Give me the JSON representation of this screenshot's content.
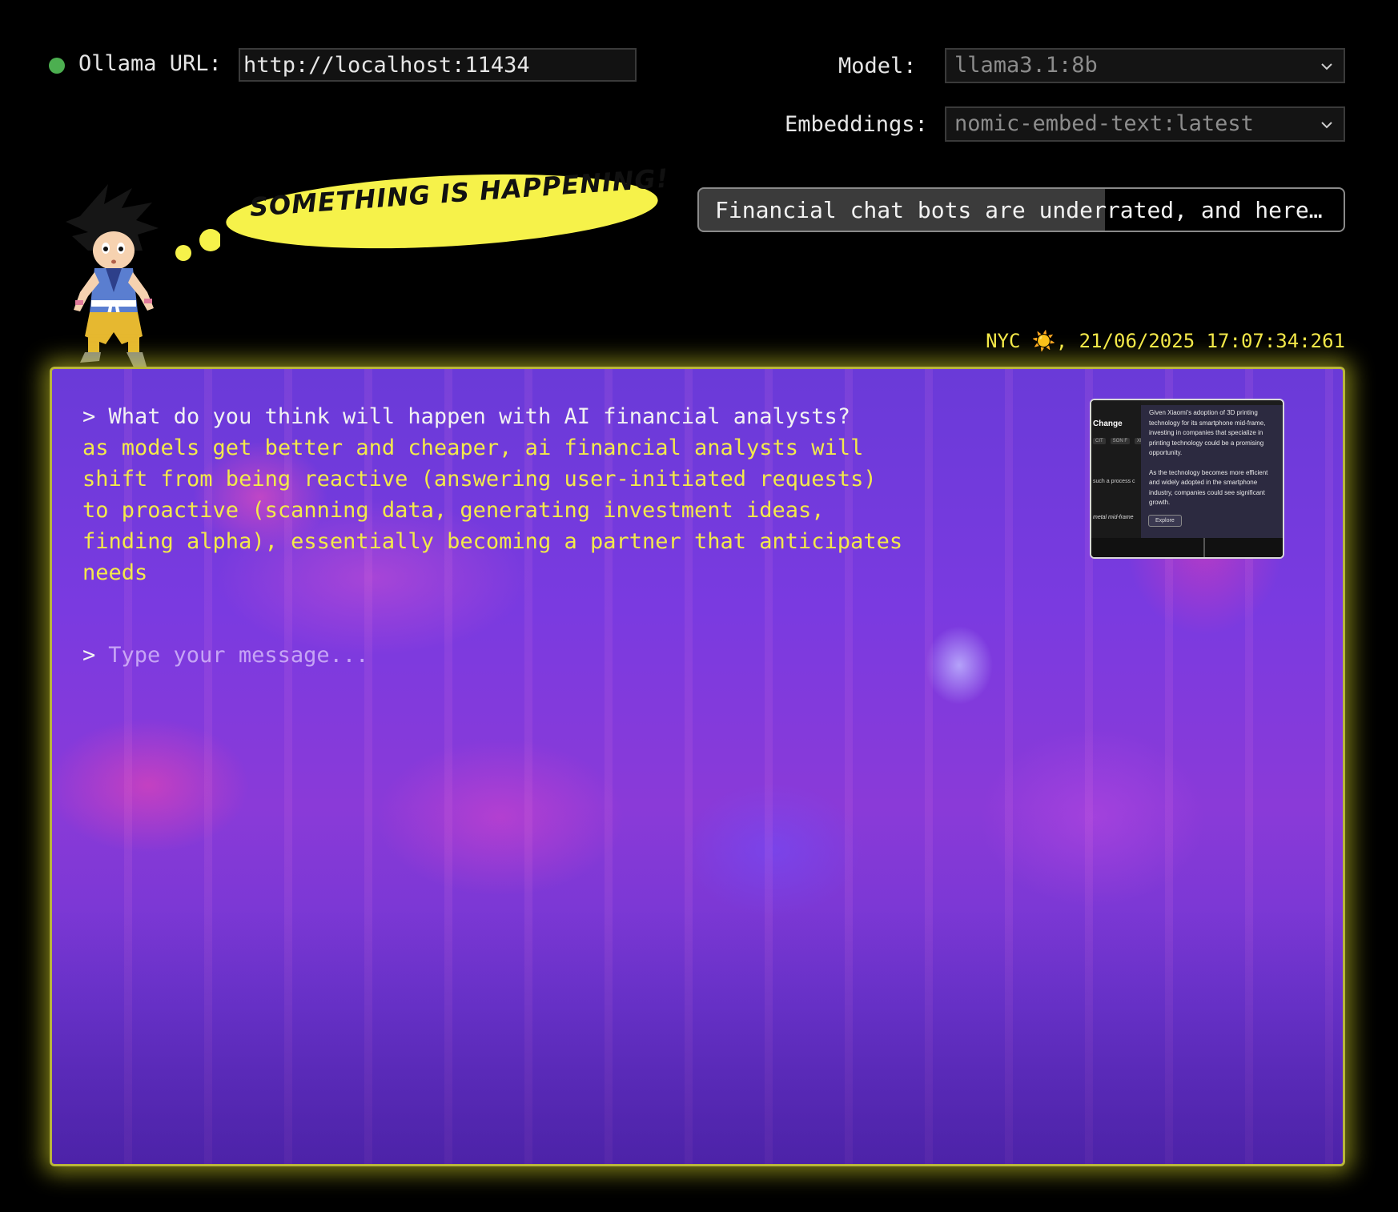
{
  "header": {
    "status": "connected",
    "status_color": "#4caf50",
    "ollama_url_label": "Ollama URL:",
    "ollama_url_value": "http://localhost:11434",
    "model_label": "Model:",
    "model_value": "llama3.1:8b",
    "embeddings_label": "Embeddings:",
    "embeddings_value": "nomic-embed-text:latest",
    "chevron_icon": "chevron-down-icon"
  },
  "mascot": {
    "bubble_text": "SOMETHING IS HAPPENING!",
    "bubble_color": "#f6f24a"
  },
  "ticker": {
    "headline": "Financial chat bots are underrated, and here…",
    "progress": 0.63
  },
  "timestamp": {
    "text": "NYC ☀️, 21/06/2025 17:07:34:261"
  },
  "chat": {
    "messages": [
      {
        "role": "user",
        "text": "> What do you think will happen with AI financial analysts?"
      },
      {
        "role": "assistant",
        "text": "as models get better and cheaper, ai financial analysts will\nshift from being reactive (answering user-initiated requests)\nto proactive (scanning data, generating investment ideas,\nfinding alpha), essentially becoming a partner that anticipates\nneeds"
      }
    ],
    "prompt_caret": ">",
    "input_placeholder": "Type your message...",
    "input_value": ""
  },
  "thumbnail": {
    "title": "Change",
    "tags": [
      "CIT",
      "SON F",
      "XIA"
    ],
    "left_text_1": "such a process c",
    "left_text_2": "metal mid-frame",
    "popover_paragraph_1": "Given Xiaomi's adoption of 3D printing technology for its smartphone mid-frame, investing in companies that specialize in printing technology could be a promising opportunity.",
    "popover_paragraph_2": "As the technology becomes more efficient and widely adopted in the smartphone industry, companies could see significant growth.",
    "explore_button": "Explore"
  },
  "colors": {
    "accent_yellow": "#f3e94a",
    "panel_glow": "#e1e128",
    "panel_purple": "#7a3ae0"
  }
}
